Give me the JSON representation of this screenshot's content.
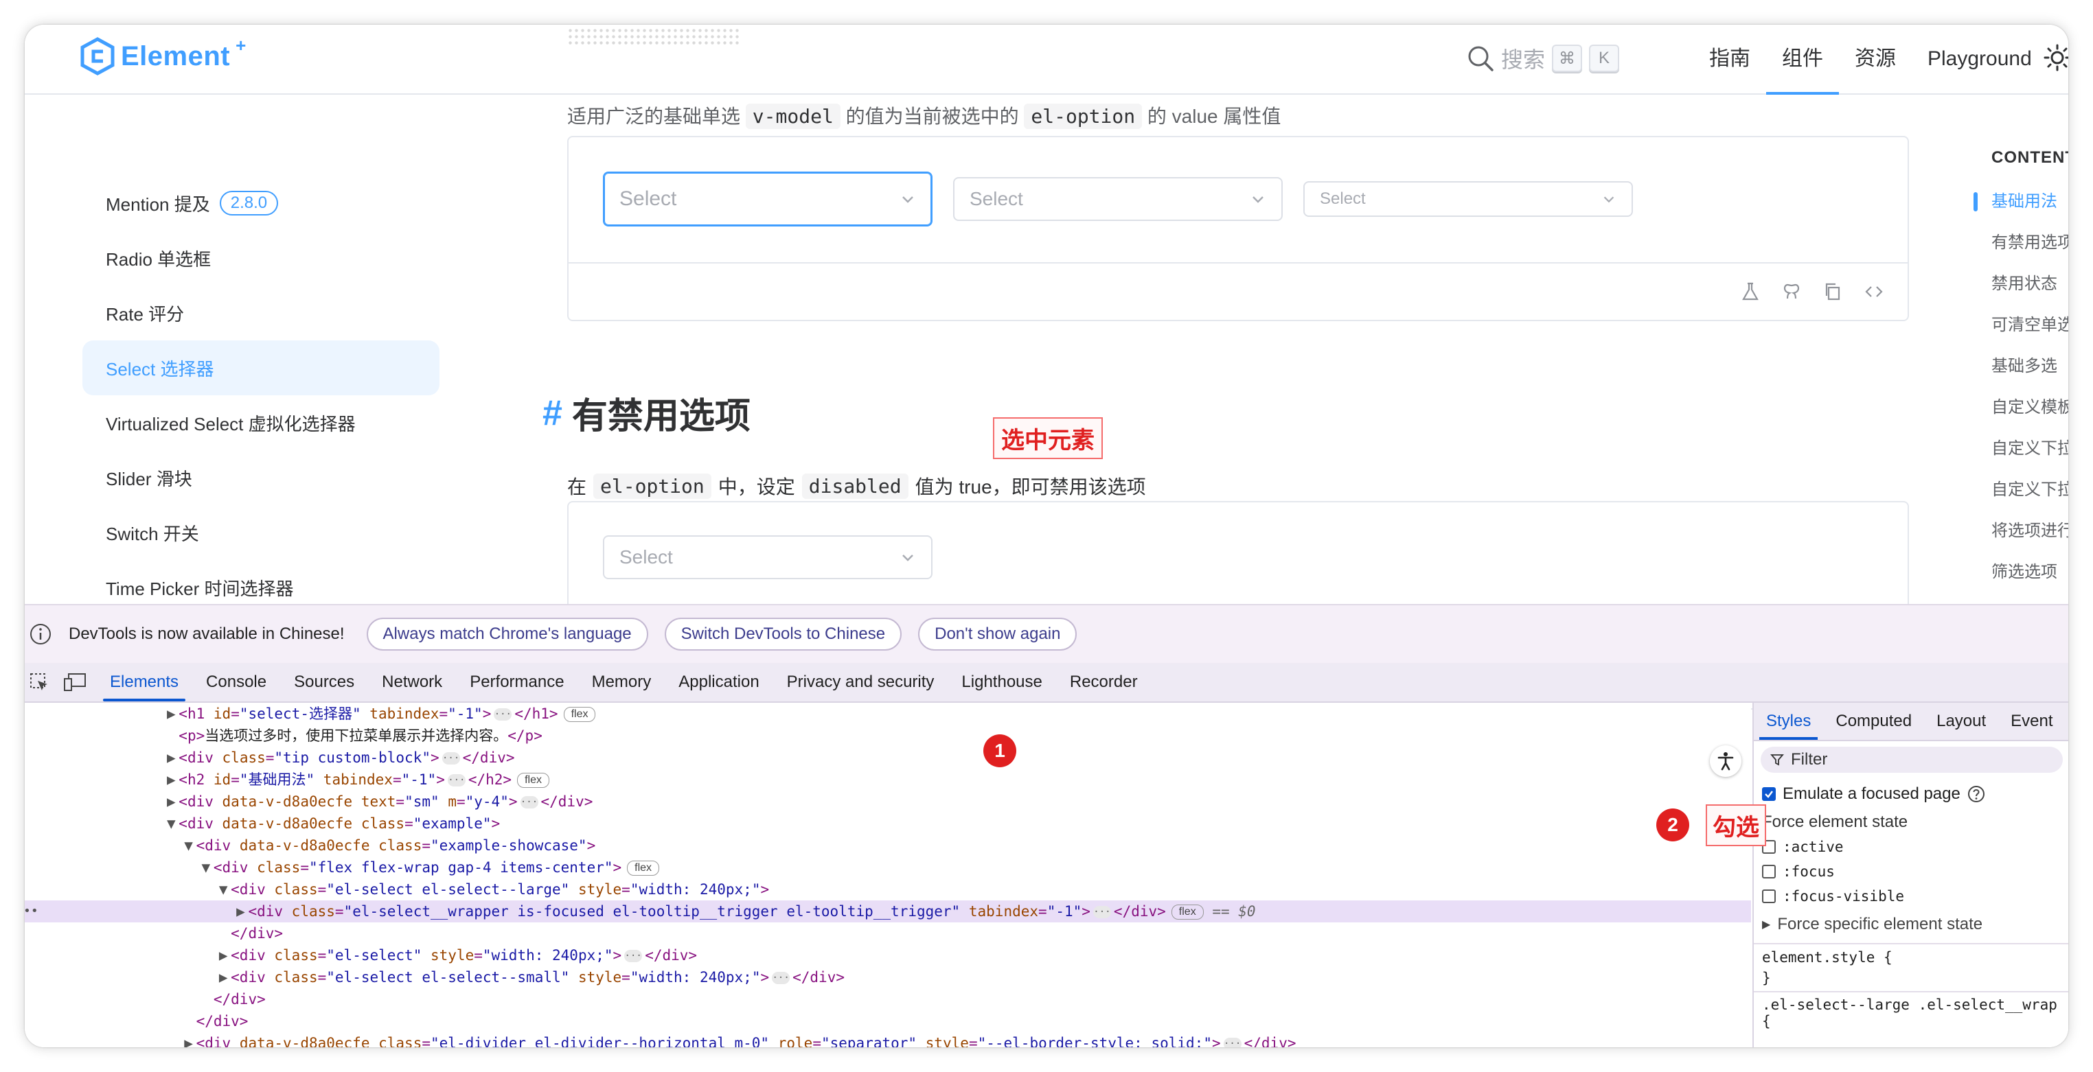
{
  "nav": {
    "logo_text": "Element",
    "logo_plus": "+",
    "search_label": "搜索",
    "kbd_cmd": "⌘",
    "kbd_k": "K",
    "links": [
      "指南",
      "组件",
      "资源",
      "Playground"
    ],
    "active_link_index": 1
  },
  "sidebar": {
    "items": [
      {
        "label": "Mention 提及",
        "badge": "2.8.0"
      },
      {
        "label": "Radio 单选框"
      },
      {
        "label": "Rate 评分"
      },
      {
        "label": "Select 选择器"
      },
      {
        "label": "Virtualized Select 虚拟化选择器"
      },
      {
        "label": "Slider 滑块"
      },
      {
        "label": "Switch 开关"
      },
      {
        "label": "Time Picker 时间选择器"
      }
    ],
    "active_index": 3
  },
  "main": {
    "cut_text_1": "适用广泛的基础单选",
    "cut_chip_1": "v-model",
    "cut_text_2": "的值为当前被选中的",
    "cut_chip_2": "el-option",
    "cut_text_3": "的 value 属性值",
    "select_placeholder": "Select",
    "section_hash": "#",
    "section_title": "有禁用选项",
    "desc_1": "在",
    "desc_chip_1": "el-option",
    "desc_2": "中，设定",
    "desc_chip_2": "disabled",
    "desc_3": "值为 true，即可禁用该选项"
  },
  "toc": {
    "title": "CONTENTS",
    "items": [
      "基础用法",
      "有禁用选项",
      "禁用状态",
      "可清空单选",
      "基础多选",
      "自定义模板",
      "自定义下拉",
      "自定义下拉",
      "将选项进行",
      "筛选选项"
    ],
    "active_index": 0
  },
  "devtools": {
    "info_text": "DevTools is now available in Chinese!",
    "pill_1": "Always match Chrome's language",
    "pill_2": "Switch DevTools to Chinese",
    "pill_3": "Don't show again",
    "tabs": [
      "Elements",
      "Console",
      "Sources",
      "Network",
      "Performance",
      "Memory",
      "Application",
      "Privacy and security",
      "Lighthouse",
      "Recorder"
    ],
    "active_tab_index": 0,
    "dom_lines": [
      {
        "indent": 8,
        "arrow": "▶",
        "html": "<h1 id=\"select-选择器\" tabindex=\"-1\">…</h1>",
        "badge": "flex"
      },
      {
        "indent": 8,
        "arrow": "",
        "html": "<p>当选项过多时，使用下拉菜单展示并选择内容。</p>"
      },
      {
        "indent": 8,
        "arrow": "▶",
        "html": "<div class=\"tip custom-block\">…</div>"
      },
      {
        "indent": 8,
        "arrow": "▶",
        "html": "<h2 id=\"基础用法\" tabindex=\"-1\">…</h2>",
        "badge": "flex"
      },
      {
        "indent": 8,
        "arrow": "▶",
        "html": "<div data-v-d8a0ecfe text=\"sm\" m=\"y-4\">…</div>"
      },
      {
        "indent": 8,
        "arrow": "▼",
        "html": "<div data-v-d8a0ecfe class=\"example\">"
      },
      {
        "indent": 9,
        "arrow": "▼",
        "html": "<div data-v-d8a0ecfe class=\"example-showcase\">"
      },
      {
        "indent": 10,
        "arrow": "▼",
        "html": "<div class=\"flex flex-wrap gap-4 items-center\">",
        "badge": "flex"
      },
      {
        "indent": 11,
        "arrow": "▼",
        "html": "<div class=\"el-select el-select--large\" style=\"width: 240px;\">"
      },
      {
        "indent": 12,
        "arrow": "▶",
        "html": "<div class=\"el-select__wrapper is-focused el-tooltip__trigger el-tooltip__trigger\" tabindex=\"-1\">…</div>",
        "badge": "flex",
        "selected": true,
        "suffix": "== $0"
      },
      {
        "indent": 11,
        "arrow": "",
        "html": "</div>"
      },
      {
        "indent": 11,
        "arrow": "▶",
        "html": "<div class=\"el-select\" style=\"width: 240px;\">…</div>"
      },
      {
        "indent": 11,
        "arrow": "▶",
        "html": "<div class=\"el-select el-select--small\" style=\"width: 240px;\">…</div>"
      },
      {
        "indent": 10,
        "arrow": "",
        "html": "</div>"
      },
      {
        "indent": 9,
        "arrow": "",
        "html": "</div>"
      },
      {
        "indent": 9,
        "arrow": "▶",
        "html": "<div data-v-d8a0ecfe class=\"el-divider el-divider--horizontal m-0\" role=\"separator\" style=\"--el-border-style: solid;\">…</div>"
      }
    ],
    "styles": {
      "tabs": [
        "Styles",
        "Computed",
        "Layout",
        "Event"
      ],
      "active_tab_index": 0,
      "filter": "Filter",
      "emulate_label": "Emulate a focused page",
      "force_state_title": "Force element state",
      "states": [
        ":active",
        ":focus",
        ":focus-visible"
      ],
      "force_specific": "Force specific element state",
      "element_style": "element.style {",
      "close_brace": "}",
      "rule_selector": ".el-select--large .el-select__wrap",
      "open_brace": "{"
    }
  },
  "annotations": {
    "note_1": "选中元素",
    "num_1": "1",
    "note_2": "勾选",
    "num_2": "2"
  },
  "colors": {
    "accent": "#409eff",
    "devtools_blue": "#0b57d0",
    "annotation_red": "#e02020"
  }
}
